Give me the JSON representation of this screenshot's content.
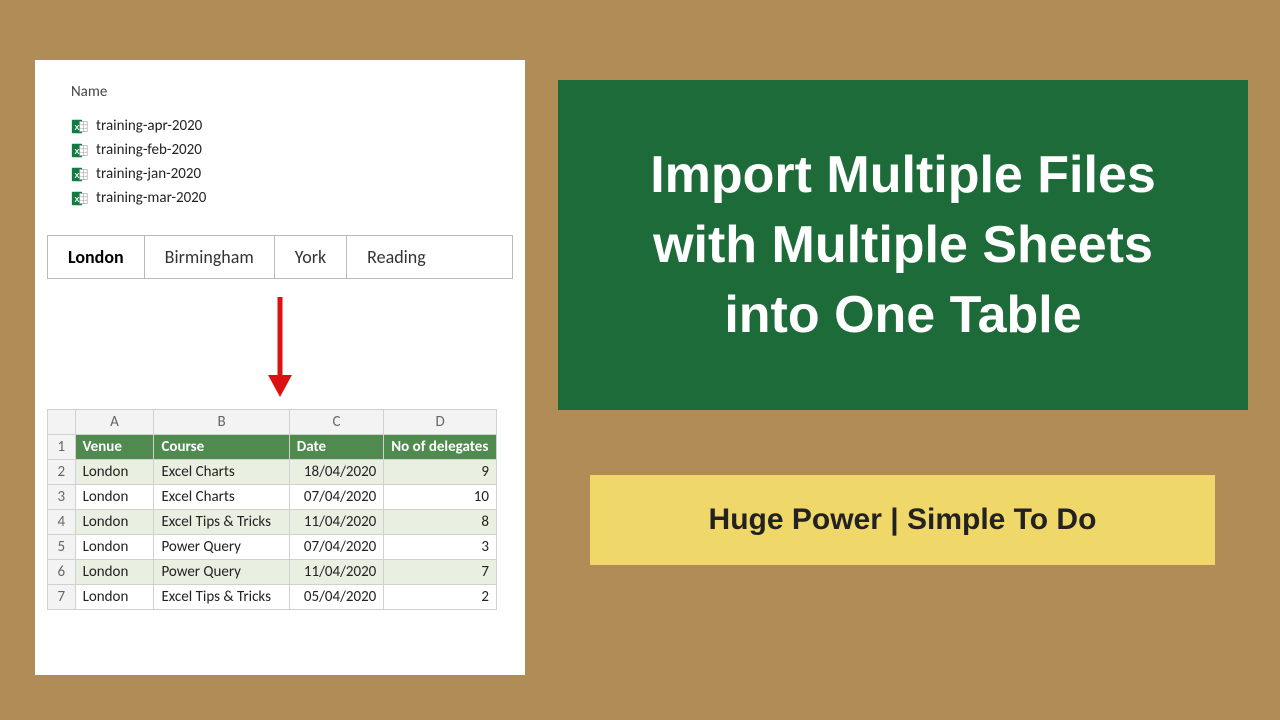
{
  "file_explorer": {
    "column_header": "Name",
    "files": [
      "training-apr-2020",
      "training-feb-2020",
      "training-jan-2020",
      "training-mar-2020"
    ]
  },
  "tabs": {
    "items": [
      "London",
      "Birmingham",
      "York",
      "Reading"
    ],
    "active_index": 0
  },
  "spreadsheet": {
    "columns": [
      "A",
      "B",
      "C",
      "D"
    ],
    "header_row_num": "1",
    "headers": [
      "Venue",
      "Course",
      "Date",
      "No of delegates"
    ],
    "rows": [
      {
        "num": "2",
        "venue": "London",
        "course": "Excel Charts",
        "date": "18/04/2020",
        "delegates": "9"
      },
      {
        "num": "3",
        "venue": "London",
        "course": "Excel Charts",
        "date": "07/04/2020",
        "delegates": "10"
      },
      {
        "num": "4",
        "venue": "London",
        "course": "Excel Tips & Tricks",
        "date": "11/04/2020",
        "delegates": "8"
      },
      {
        "num": "5",
        "venue": "London",
        "course": "Power Query",
        "date": "07/04/2020",
        "delegates": "3"
      },
      {
        "num": "6",
        "venue": "London",
        "course": "Power Query",
        "date": "11/04/2020",
        "delegates": "7"
      },
      {
        "num": "7",
        "venue": "London",
        "course": "Excel Tips & Tricks",
        "date": "05/04/2020",
        "delegates": "2"
      }
    ]
  },
  "title_card": {
    "line1": "Import Multiple Files",
    "line2": "with Multiple Sheets",
    "line3": "into One Table"
  },
  "subtitle_card": "Huge Power | Simple To Do"
}
